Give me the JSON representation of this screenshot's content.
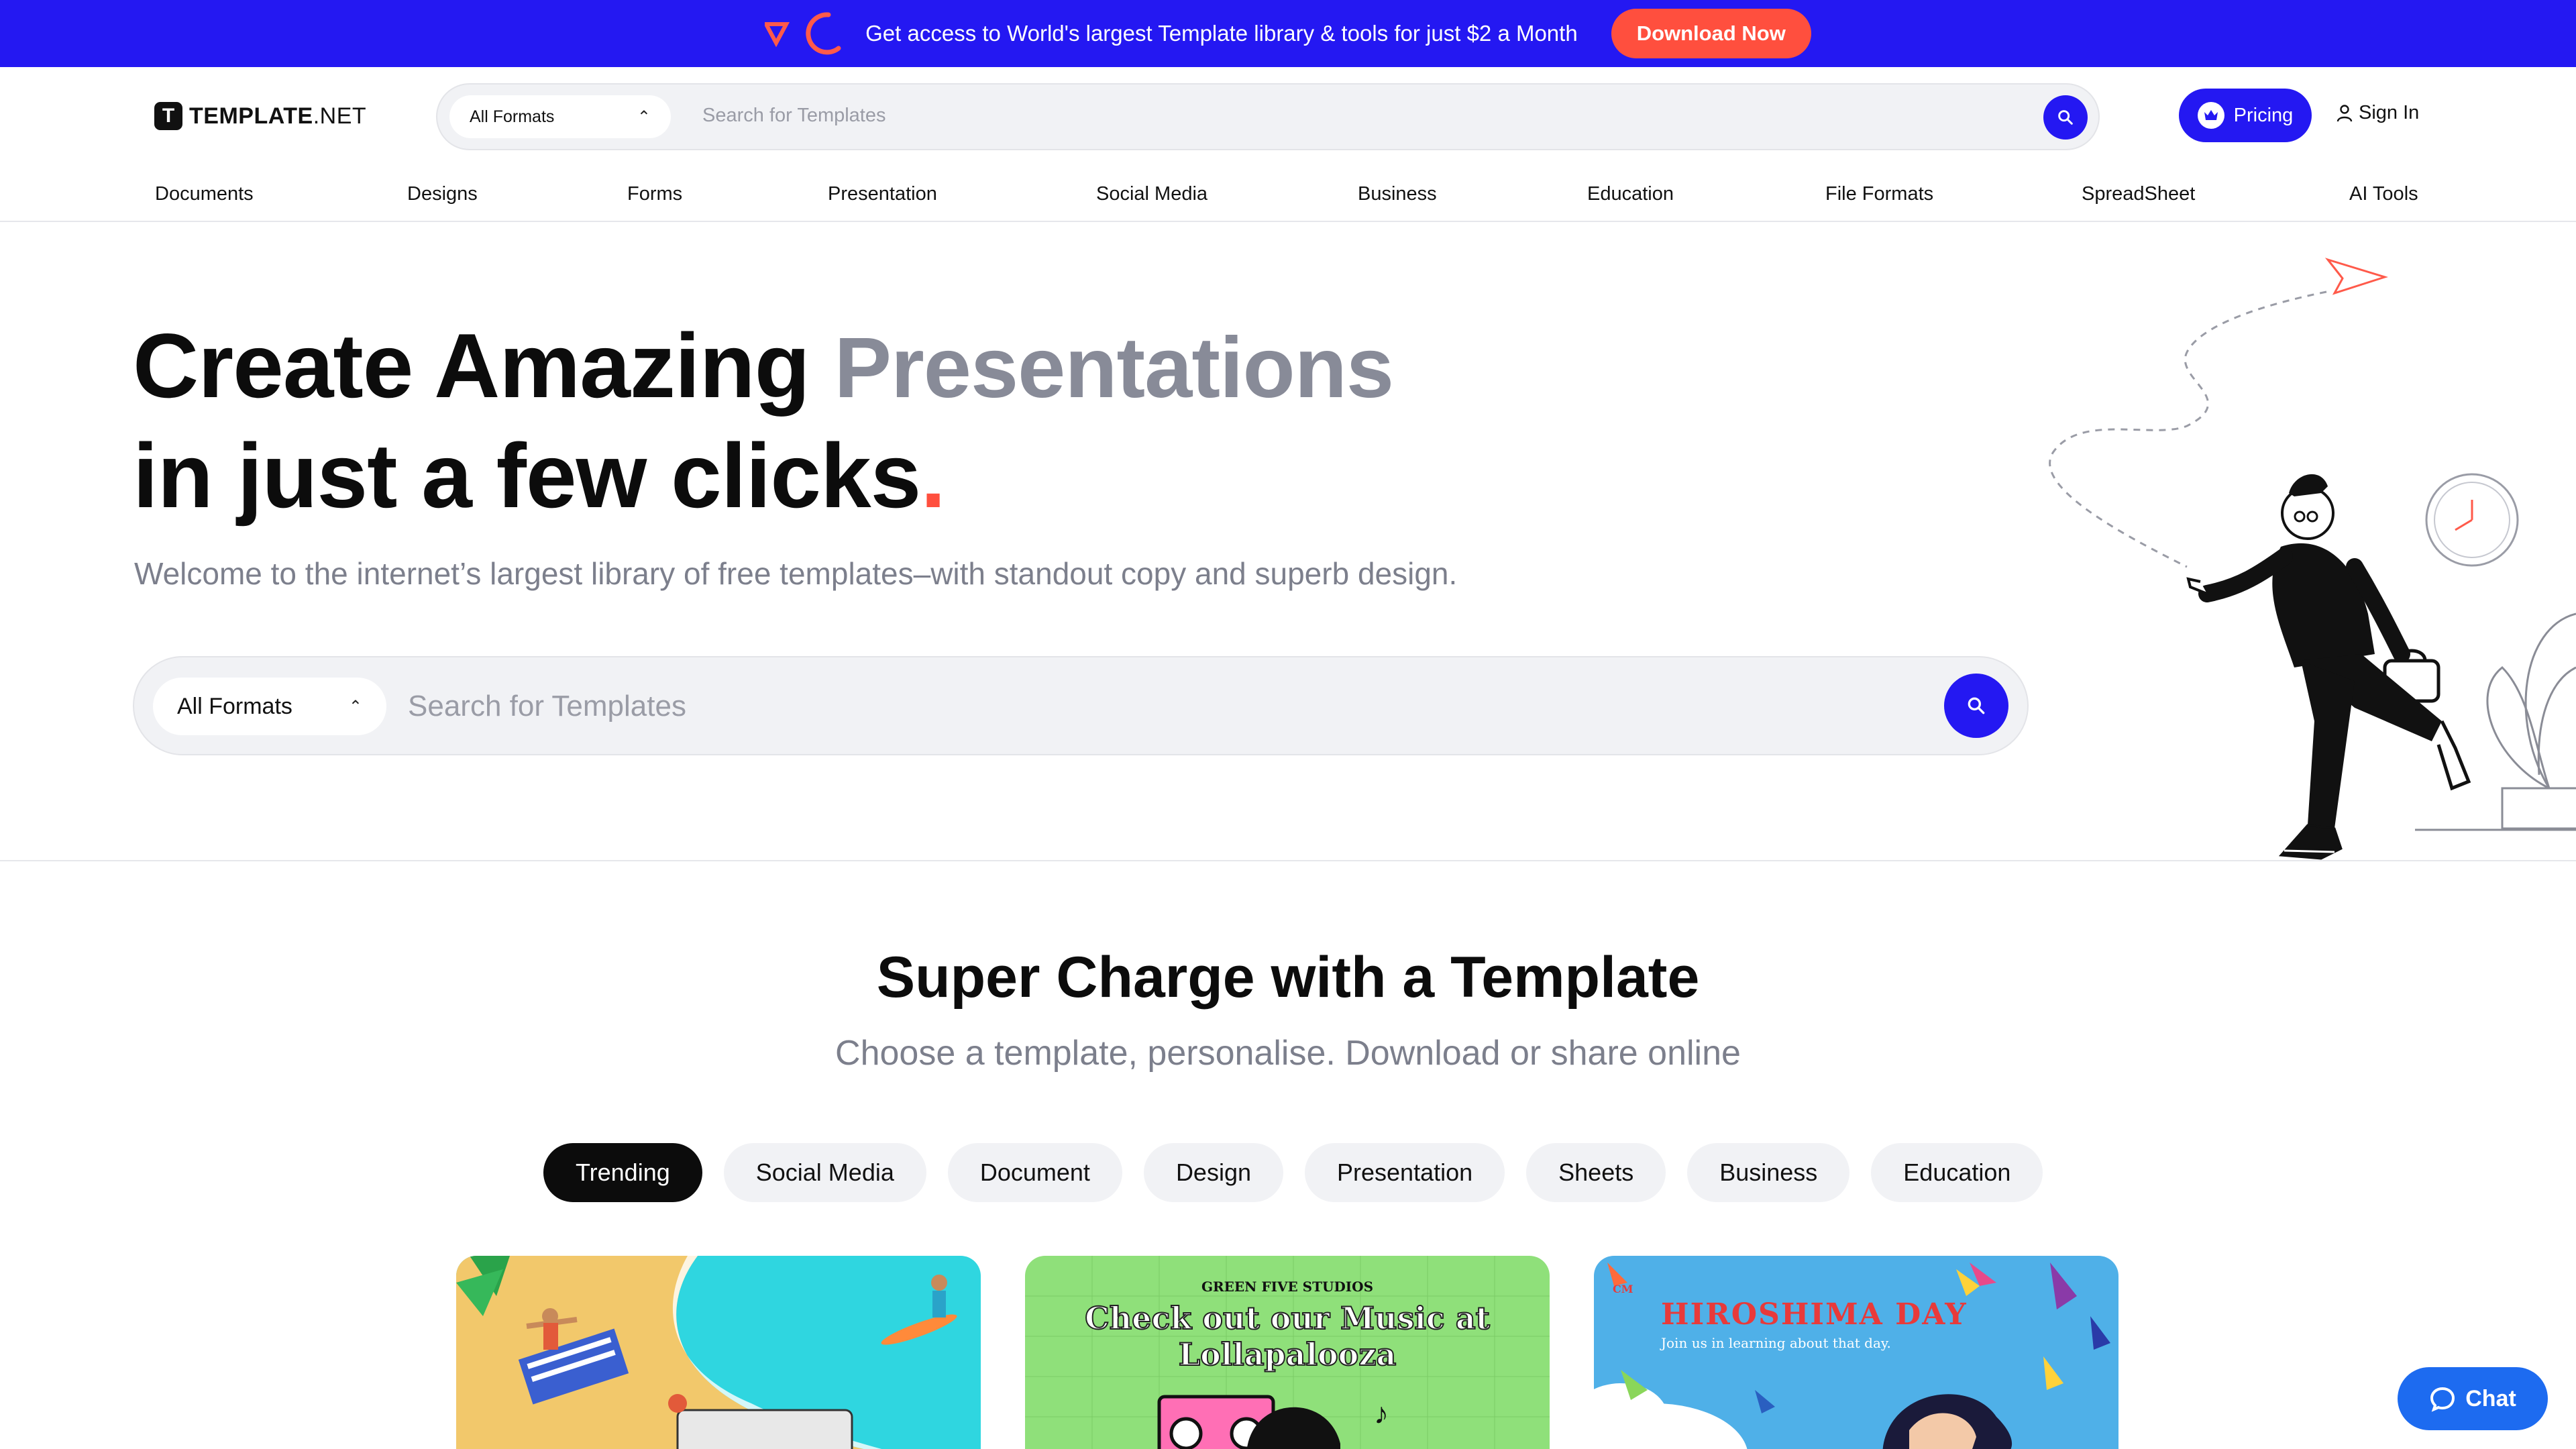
{
  "promo": {
    "text": "Get access to World's largest Template library & tools for just $2 a Month",
    "button": "Download Now",
    "colors": {
      "bar": "#2418f2",
      "button": "#ff4f3e"
    }
  },
  "header": {
    "logo": {
      "mark": "T",
      "text_bold": "TEMPLATE",
      "text_light": ".NET"
    },
    "search": {
      "format": "All Formats",
      "placeholder": "Search for Templates"
    },
    "pricing": "Pricing",
    "signin": "Sign In"
  },
  "nav": {
    "categories": [
      "Documents",
      "Designs",
      "Forms",
      "Presentation",
      "Social Media",
      "Business",
      "Education",
      "File Formats",
      "SpreadSheet",
      "AI Tools"
    ]
  },
  "hero": {
    "title_line1": "Create Amazing",
    "title_accent": "Presentations",
    "title_line2": "in just a few clicks",
    "title_dot": ".",
    "subtitle": "Welcome to the internet’s largest library of free templates–with standout copy and superb design.",
    "search": {
      "format": "All Formats",
      "placeholder": "Search for Templates"
    }
  },
  "section": {
    "title": "Super Charge with a Template",
    "subtitle": "Choose a template, personalise. Download or share online",
    "tabs": [
      "Trending",
      "Social Media",
      "Document",
      "Design",
      "Presentation",
      "Sheets",
      "Business",
      "Education"
    ],
    "active_tab": "Trending"
  },
  "cards": [
    {
      "kind": "beach-illustration"
    },
    {
      "studio": "GREEN FIVE STUDIOS",
      "headline_line1": "Check out our Music at",
      "headline_line2": "Lollapalooza"
    },
    {
      "badge": "CM",
      "title": "HIROSHIMA DAY",
      "subtitle": "Join us in learning about that day."
    }
  ],
  "chat": {
    "label": "Chat"
  },
  "icons": [
    "search-icon",
    "chevron-up-icon",
    "crown-icon",
    "user-icon",
    "chat-bubble-icon",
    "logo-icon"
  ]
}
